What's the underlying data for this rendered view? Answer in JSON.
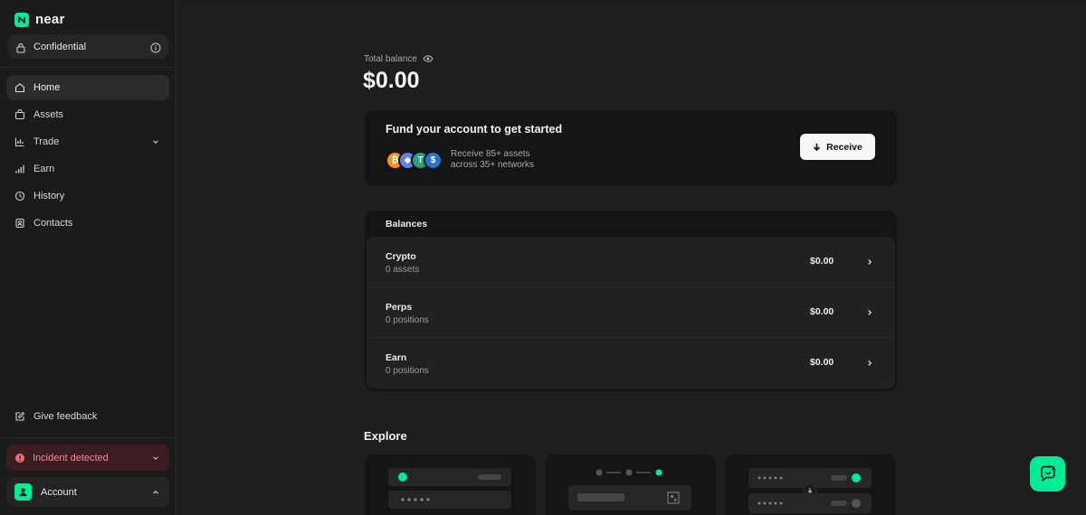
{
  "brand": {
    "name": "near"
  },
  "sidebar": {
    "confidential_label": "Confidential",
    "items": [
      {
        "label": "Home",
        "icon": "home-icon",
        "active": true
      },
      {
        "label": "Assets",
        "icon": "bag-icon"
      },
      {
        "label": "Trade",
        "icon": "chart-icon"
      },
      {
        "label": "Earn",
        "icon": "bars-icon"
      },
      {
        "label": "History",
        "icon": "history-icon"
      },
      {
        "label": "Contacts",
        "icon": "contacts-icon"
      }
    ],
    "feedback_label": "Give feedback",
    "incident_label": "Incident detected",
    "account_label": "Account"
  },
  "main": {
    "total_balance_label": "Total balance",
    "total_balance_value": "$0.00",
    "fund": {
      "title": "Fund your account to get started",
      "sub_line1": "Receive 85+ assets",
      "sub_line2": "across 35+ networks",
      "receive_label": "Receive"
    },
    "balances": {
      "title": "Balances",
      "rows": [
        {
          "name": "Crypto",
          "sub": "0 assets",
          "value": "$0.00"
        },
        {
          "name": "Perps",
          "sub": "0 positions",
          "value": "$0.00"
        },
        {
          "name": "Earn",
          "sub": "0 positions",
          "value": "$0.00"
        }
      ]
    },
    "explore_title": "Explore"
  },
  "colors": {
    "accent": "#00ec97",
    "incident_bg": "#3b1d21",
    "incident_text": "#f28a93"
  }
}
